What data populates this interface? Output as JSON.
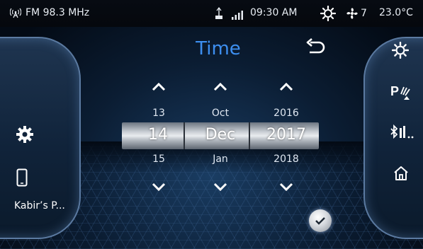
{
  "status": {
    "radio": "FM 98.3 MHz",
    "time": "09:30 AM",
    "fan_speed": "7",
    "temperature": "23.0°C"
  },
  "screen": {
    "title": "Time"
  },
  "left_panel": {
    "phone_name": "Kabir’s P..."
  },
  "picker": {
    "columns": [
      {
        "prev": "13",
        "current": "14",
        "next": "15"
      },
      {
        "prev": "Oct",
        "current": "Dec",
        "next": "Jan"
      },
      {
        "prev": "2016",
        "current": "2017",
        "next": "2018"
      }
    ]
  },
  "right_panel": {
    "bluetooth_label": "*ı̇.."
  },
  "icons": {
    "radio": "radio-signal-icon",
    "usb": "usb-icon",
    "signal": "signal-bars-icon",
    "ac": "ac-icon",
    "fan": "fan-icon",
    "back": "back-arrow-icon",
    "settings": "gear-icon",
    "phone": "phone-icon",
    "parking": "parking-sensor-icon",
    "bluetooth": "bluetooth-icon",
    "home": "home-icon",
    "confirm": "checkmark-icon"
  },
  "colors": {
    "title": "#3d8ff0",
    "panel_border": "#5b7aa1"
  }
}
